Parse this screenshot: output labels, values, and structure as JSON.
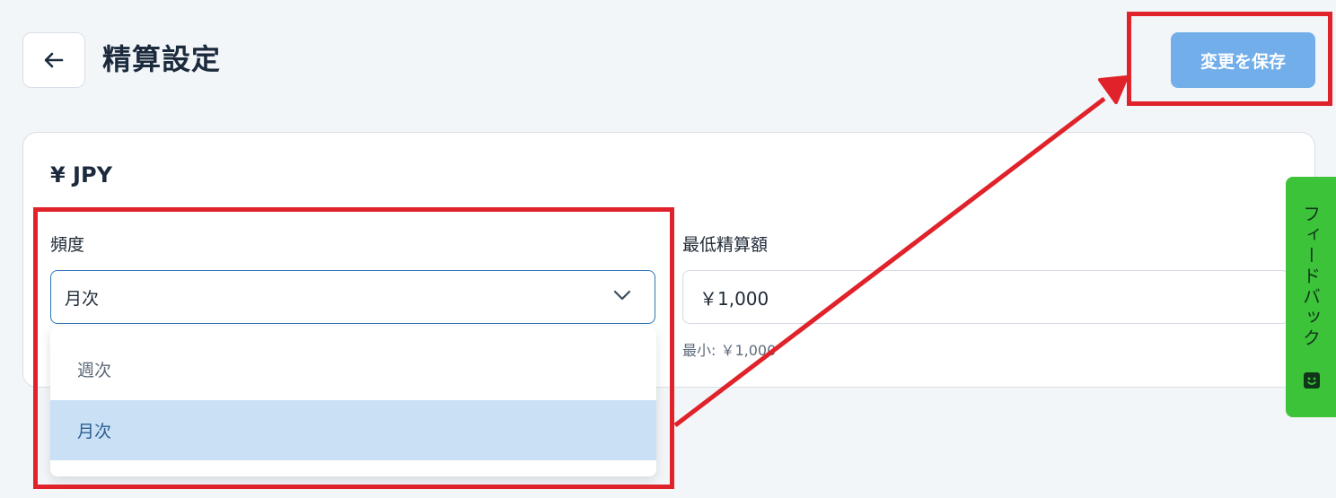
{
  "header": {
    "back_icon": "arrow-left-icon",
    "title": "精算設定",
    "save_label": "変更を保存",
    "save_color": "#72aeea"
  },
  "card": {
    "currency_title": "¥ JPY",
    "frequency": {
      "label": "頻度",
      "selected_value": "月次",
      "options": [
        "週次",
        "月次"
      ],
      "icon": "chevron-down-icon"
    },
    "min_amount": {
      "label": "最低精算額",
      "value": "￥1,000",
      "hint": "最小: ￥1,000"
    }
  },
  "feedback": {
    "label": "フィードバック",
    "icon": "chat-smile-icon",
    "color": "#3cc339"
  },
  "annotation_color": "#e0222a"
}
